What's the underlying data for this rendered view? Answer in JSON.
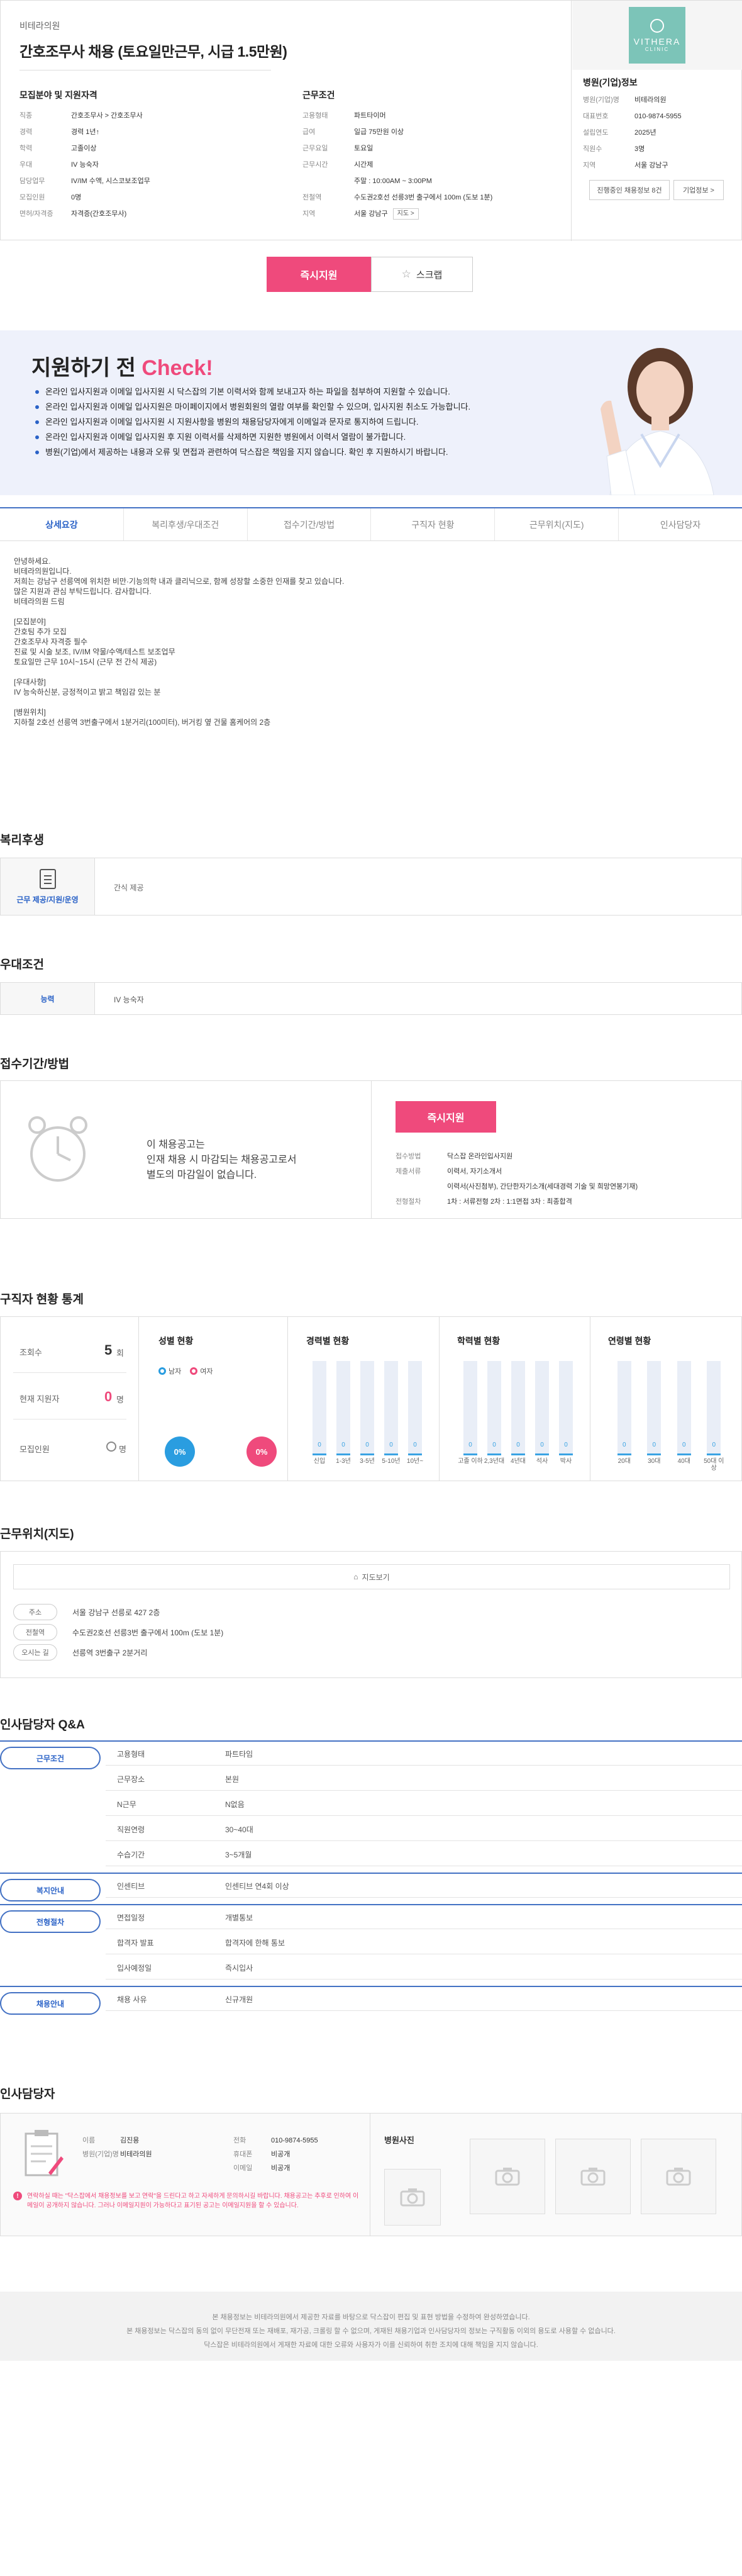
{
  "header": {
    "hospital_name": "비테라의원",
    "job_title": "간호조무사 채용 (토요일만근무, 시급 1.5만원)"
  },
  "recruit": {
    "section_title": "모집분야 및 지원자격",
    "rows": [
      {
        "k": "직종",
        "v": "간호조무사 > 간호조무사"
      },
      {
        "k": "경력",
        "v": "경력 1년↑"
      },
      {
        "k": "학력",
        "v": "고졸이상"
      },
      {
        "k": "우대",
        "v": "IV 능숙자"
      },
      {
        "k": "담당업무",
        "v": "IV/IM 수액, 시스코보조업무"
      },
      {
        "k": "모집인원",
        "v": "0명"
      },
      {
        "k": "면허/자격증",
        "v": "자격증(간호조무사)"
      }
    ]
  },
  "work": {
    "section_title": "근무조건",
    "rows": [
      {
        "k": "고용형태",
        "v": "파트타이머"
      },
      {
        "k": "급여",
        "v": "일급 75만원 이상"
      },
      {
        "k": "근무요일",
        "v": "토요일"
      },
      {
        "k": "근무시간",
        "v": "시간제"
      },
      {
        "k": "",
        "v": "주말 : 10:00AM ~ 3:00PM"
      },
      {
        "k": "전철역",
        "v": "수도권2호선 선릉3번 출구에서 100m (도보 1분)"
      },
      {
        "k": "지역",
        "v": "서울 강남구"
      }
    ],
    "map_btn": "지도 >"
  },
  "company": {
    "logo_text": "VITHERA",
    "logo_sub": "CLINIC",
    "section_title": "병원(기업)정보",
    "rows": [
      {
        "k": "병원(기업)명",
        "v": "비테라의원"
      },
      {
        "k": "대표번호",
        "v": "010-9874-5955"
      },
      {
        "k": "설립연도",
        "v": "2025년"
      },
      {
        "k": "직원수",
        "v": "3명"
      },
      {
        "k": "지역",
        "v": "서울 강남구"
      }
    ],
    "btn_other": "진행중인 채용정보 8건",
    "btn_info": "기업정보 >"
  },
  "actions": {
    "apply": "즉시지원",
    "scrap": "스크랩"
  },
  "banner": {
    "title_plain": "지원하기 전",
    "title_highlight": "Check!",
    "items": [
      "온라인 입사지원과 이메일 입사지원 시 닥스잡의 기본 이력서와 함께 보내고자 하는 파일을 첨부하여 지원할 수 있습니다.",
      "온라인 입사지원과 이메일 입사지원은 마이페이지에서 병원회원의 열람 여부를 확인할 수 있으며, 입사지원 취소도 가능합니다.",
      "온라인 입사지원과 이메일 입사지원 시 지원사항을 병원의 채용담당자에게 이메일과 문자로 통지하여 드립니다.",
      "온라인 입사지원과 이메일 입사지원 후 지원 이력서를 삭제하면 지원한 병원에서 이력서 열람이 불가합니다.",
      "병원(기업)에서 제공하는 내용과 오류 및 면접과 관련하여 닥스잡은 책임을 지지 않습니다. 확인 후 지원하시기 바랍니다."
    ]
  },
  "tabs": [
    "상세요강",
    "복리후생/우대조건",
    "접수기간/방법",
    "구직자 현황",
    "근무위치(지도)",
    "인사담당자"
  ],
  "detail": {
    "lines": [
      "안녕하세요.",
      "비테라의원입니다.",
      "저희는 강남구 선릉역에 위치한 비만·기능의학 내과 클리닉으로, 함께 성장할 소중한 인재를 찾고 있습니다.",
      "많은 지원과 관심 부탁드립니다. 감사합니다.",
      "비테라의원 드림",
      "",
      "[모집분야]",
      "간호팀 추가 모집",
      "간호조무사 자격증 필수",
      "진료 및 시술 보조, IV/IM 약물/수액/테스트 보조업무",
      "토요일만 근무 10시~15시 (근무 전 간식 제공)",
      "",
      "[우대사항]",
      "IV 능숙하신분, 긍정적이고 밝고 책임감 있는 분",
      "",
      "[병원위치]",
      "지하철 2호선 선릉역 3번출구에서 1분거리(100미터), 버거킹 옆 건물 홈케어의 2층"
    ]
  },
  "benefit": {
    "section_title": "복리후생",
    "category": "근무 제공/지원/운영",
    "value": "간식 제공"
  },
  "prefer": {
    "section_title": "우대조건",
    "label": "능력",
    "value": "IV 능숙자"
  },
  "receipt": {
    "section_title": "접수기간/방법",
    "notice_lines": [
      "이 채용공고는",
      "인재 채용 시 마감되는 채용공고로서",
      "별도의 마감일이 없습니다."
    ],
    "apply_btn": "즉시지원",
    "rows": [
      {
        "k": "접수방법",
        "v": "닥스잡 온라인입사지원"
      },
      {
        "k": "제출서류",
        "v": "이력서, 자기소개서"
      },
      {
        "k": "",
        "v": "이력서(사진첨부), 간단한자기소개(세대경력 기술 및 희망연봉기재)"
      },
      {
        "k": "전형절차",
        "v": "1차 : 서류전형    2차 : 1:1면접    3차 : 최종합격"
      }
    ]
  },
  "stats": {
    "section_title": "구직자 현황 통계",
    "views_label": "조회수",
    "views": "5",
    "views_unit": "회",
    "applicants_label": "현재 지원자",
    "applicants": "0",
    "applicants_unit": "명",
    "recruits_label": "모집인원",
    "recruits": "0",
    "recruits_unit": "명",
    "gender_title": "성별 현황",
    "gender_legend": [
      "남자",
      "여자"
    ],
    "gender_values": [
      "0%",
      "0%"
    ],
    "career_title": "경력별 현황",
    "career": {
      "labels": [
        "신입",
        "1-3년",
        "3-5년",
        "5-10년",
        "10년~"
      ],
      "values": [
        0,
        0,
        0,
        0,
        0
      ]
    },
    "edu_title": "학력별 현황",
    "edu": {
      "labels": [
        "고졸 이하",
        "2,3년대",
        "4년대",
        "석사",
        "박사"
      ],
      "values": [
        0,
        0,
        0,
        0,
        0
      ]
    },
    "age_title": "연령별 현황",
    "age": {
      "labels": [
        "20대",
        "30대",
        "40대",
        "50대 이상"
      ],
      "values": [
        0,
        0,
        0,
        0
      ]
    },
    "bar_value_label": "0"
  },
  "location": {
    "section_title": "근무위치(지도)",
    "map_btn": "지도보기",
    "rows": [
      {
        "k": "주소",
        "v": "서울 강남구 선릉로 427 2층"
      },
      {
        "k": "전철역",
        "v": "수도권2호선 선릉3번 출구에서 100m (도보 1분)"
      },
      {
        "k": "오시는 길",
        "v": "선릉역 3번출구 2분거리"
      }
    ]
  },
  "qa": {
    "section_title": "인사담당자 Q&A",
    "groups": [
      {
        "cat": "근무조건",
        "rows": [
          {
            "q": "고용형태",
            "a": "파트타임"
          },
          {
            "q": "근무장소",
            "a": "본원"
          },
          {
            "q": "N근무",
            "a": "N없음"
          },
          {
            "q": "직원연령",
            "a": "30~40대"
          },
          {
            "q": "수습기간",
            "a": "3~5개월"
          }
        ]
      },
      {
        "cat": "복지안내",
        "rows": [
          {
            "q": "인센티브",
            "a": "인센티브 연4회 이상"
          }
        ]
      },
      {
        "cat": "전형절차",
        "rows": [
          {
            "q": "면접일정",
            "a": "개별통보"
          },
          {
            "q": "합격자 발표",
            "a": "합격자에 한해 통보"
          },
          {
            "q": "입사예정일",
            "a": "즉시입사"
          }
        ]
      },
      {
        "cat": "채용안내",
        "rows": [
          {
            "q": "채용 사유",
            "a": "신규개원"
          }
        ]
      }
    ]
  },
  "manager": {
    "section_title": "인사담당자",
    "rows_left": [
      {
        "k": "이름",
        "v": "김진용"
      },
      {
        "k": "병원(기업)명",
        "v": "비테라의원"
      }
    ],
    "rows_right": [
      {
        "k": "전화",
        "v": "010-9874-5955"
      },
      {
        "k": "휴대폰",
        "v": "비공개"
      },
      {
        "k": "이메일",
        "v": "비공개"
      }
    ],
    "photos_title": "병원사진",
    "warning": "연락하실 때는 \"닥스잡에서 채용정보를 보고 연락\"을 드린다고 하고 자세하게 문의하시길 바랍니다. 채용공고는 추후로 인하여 이메일이 공개하지 않습니다. 그러나 이메일지원이 가능하다고 표기된 공고는 이메일지원을 할 수 있습니다."
  },
  "footer": {
    "lines": [
      "본 채용정보는 비테라의원에서 제공한 자료를 바탕으로 닥스잡이 편집 및 표현 방법을 수정하여 완성하였습니다.",
      "본 채용정보는 닥스잡의 동의 없이 무단전재 또는 재배포, 재가공, 크롤링 할 수 없으며, 게재된 채용기업과 인사담당자의 정보는 구직활동 이외의 용도로 사용할 수 없습니다.",
      "닥스잡은 비테라의원에서 게재한 자료에 대한 오류와 사용자가 이를 신뢰하여 취한 조치에 대해 책임을 지지 않습니다."
    ]
  },
  "colors": {
    "accent": "#2a62c7",
    "pink": "#ef4a7c",
    "teal": "#7cc4b8"
  }
}
